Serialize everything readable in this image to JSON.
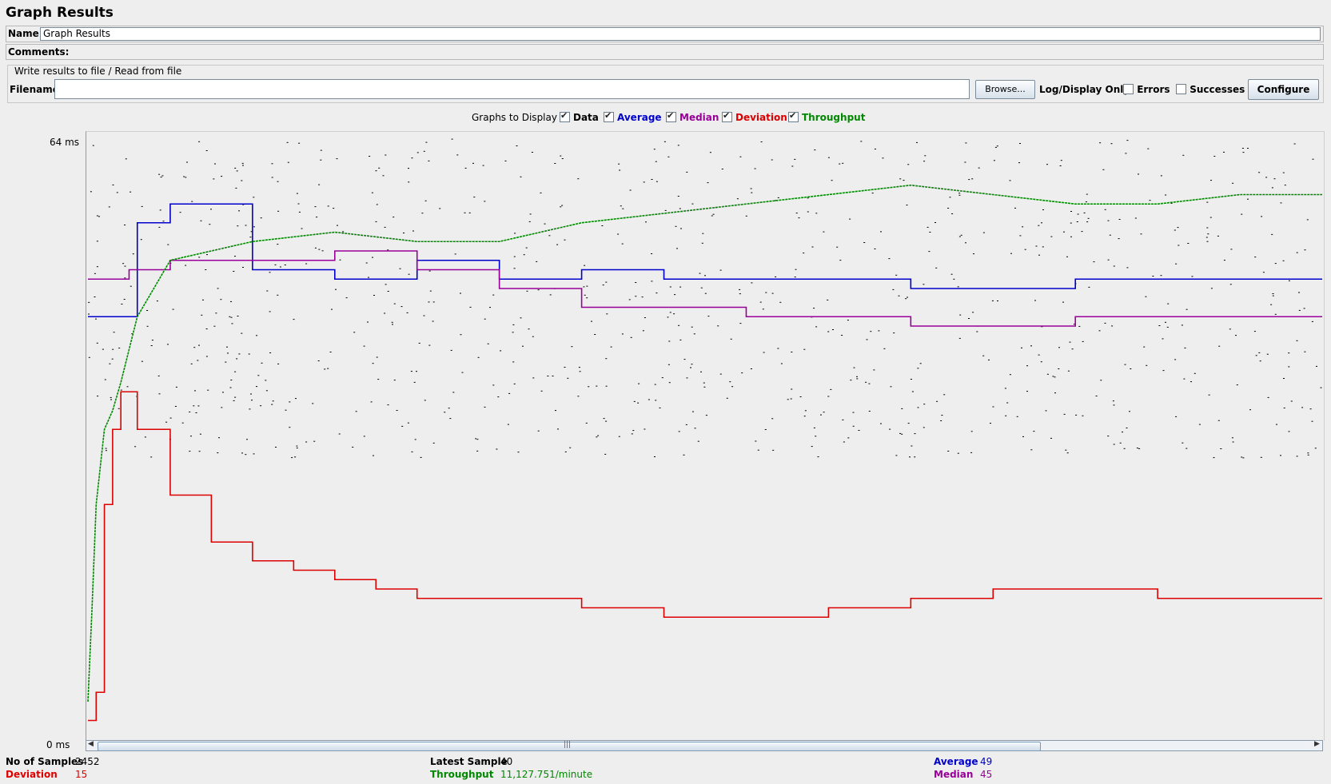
{
  "panel": {
    "title": "Graph Results",
    "name_label": "Name:",
    "name_value": "Graph Results",
    "comments_label": "Comments:",
    "comments_value": ""
  },
  "file_group": {
    "title": "Write results to file / Read from file",
    "filename_label": "Filename",
    "filename_value": "",
    "browse_label": "Browse...",
    "log_display_label": "Log/Display Only:",
    "errors_label": "Errors",
    "errors_checked": false,
    "successes_label": "Successes",
    "successes_checked": false,
    "configure_label": "Configure"
  },
  "graphs_to_display": {
    "label": "Graphs to Display",
    "options": [
      {
        "label": "Data",
        "checked": true,
        "color": "#000000"
      },
      {
        "label": "Average",
        "checked": true,
        "color": "#0000cc"
      },
      {
        "label": "Median",
        "checked": true,
        "color": "#990099"
      },
      {
        "label": "Deviation",
        "checked": true,
        "color": "#dd0000"
      },
      {
        "label": "Throughput",
        "checked": true,
        "color": "#008800"
      }
    ]
  },
  "chart_data": {
    "type": "line",
    "y_max_label": "64  ms",
    "y_min_label": "0  ms",
    "ylim": [
      0,
      64
    ],
    "grid": false,
    "series": [
      {
        "name": "Average",
        "color": "#0000cc",
        "x": [
          0,
          40,
          60,
          100,
          200,
          300,
          400,
          500,
          600,
          700,
          800,
          900,
          1000,
          1100,
          1200,
          1300,
          1400,
          1500
        ],
        "y": [
          45,
          45,
          55,
          57,
          50,
          49,
          51,
          49,
          50,
          49,
          49,
          49,
          48,
          48,
          49,
          49,
          49,
          49
        ]
      },
      {
        "name": "Median",
        "color": "#990099",
        "x": [
          0,
          50,
          100,
          200,
          300,
          400,
          500,
          600,
          700,
          800,
          900,
          1000,
          1100,
          1200,
          1300,
          1400,
          1500
        ],
        "y": [
          49,
          50,
          51,
          51,
          52,
          50,
          48,
          46,
          46,
          45,
          45,
          44,
          44,
          45,
          45,
          45,
          45
        ]
      },
      {
        "name": "Deviation",
        "color": "#dd0000",
        "x": [
          0,
          10,
          20,
          30,
          40,
          60,
          100,
          150,
          200,
          250,
          300,
          350,
          400,
          500,
          600,
          700,
          800,
          900,
          1000,
          1100,
          1200,
          1300,
          1400,
          1500
        ],
        "y": [
          2,
          5,
          25,
          33,
          37,
          33,
          26,
          21,
          19,
          18,
          17,
          16,
          15,
          15,
          14,
          13,
          13,
          14,
          15,
          16,
          16,
          15,
          15,
          15
        ]
      },
      {
        "name": "Throughput",
        "color": "#008800",
        "x": [
          0,
          5,
          10,
          20,
          30,
          40,
          60,
          100,
          200,
          300,
          400,
          500,
          600,
          700,
          800,
          900,
          1000,
          1100,
          1200,
          1300,
          1400,
          1500
        ],
        "y": [
          4,
          14,
          25,
          33,
          35,
          38,
          45,
          51,
          53,
          54,
          53,
          53,
          55,
          56,
          57,
          58,
          59,
          58,
          57,
          57,
          58,
          58
        ]
      }
    ]
  },
  "scroll": {
    "left_arrow": "◀",
    "right_arrow": "▶",
    "grip": "|||"
  },
  "stats": {
    "samples_label": "No of Samples",
    "samples_value": "2452",
    "deviation_label": "Deviation",
    "deviation_value": "15",
    "latest_label": "Latest Sample",
    "latest_value": "40",
    "throughput_label": "Throughput",
    "throughput_value": "11,127.751/minute",
    "average_label": "Average",
    "average_value": "49",
    "median_label": "Median",
    "median_value": "45"
  }
}
